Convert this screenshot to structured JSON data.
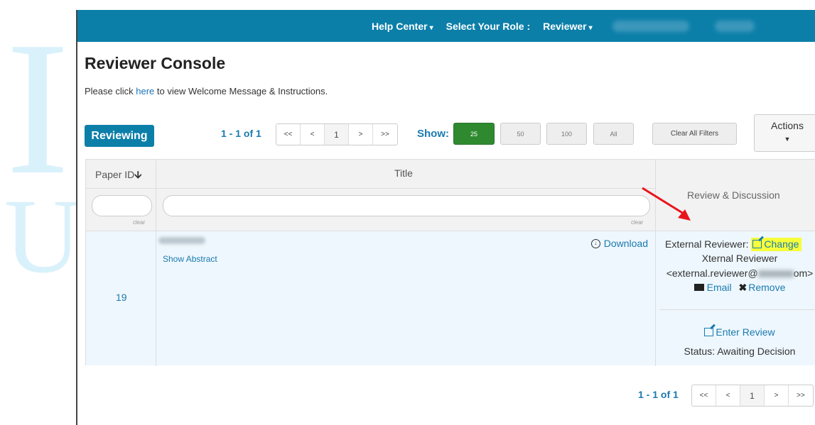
{
  "decor": {
    "letter_top": "I",
    "letter_bottom": "U"
  },
  "topbar": {
    "help_center": "Help Center",
    "select_role_label": "Select Your Role :",
    "role_value": "Reviewer"
  },
  "page": {
    "title": "Reviewer Console",
    "intro_prefix": "Please click ",
    "intro_link": "here",
    "intro_suffix": " to view Welcome Message & Instructions."
  },
  "toolbar": {
    "reviewing_label": "Reviewing",
    "pagination_info": "1 - 1 of 1",
    "pager": [
      "<<",
      "<",
      "1",
      ">",
      ">>"
    ],
    "show_label": "Show:",
    "show_options": [
      "25",
      "50",
      "100",
      "All"
    ],
    "show_selected": "25",
    "clear_filters": "Clear All Filters",
    "actions_label": "Actions"
  },
  "table": {
    "headers": {
      "paper_id": "Paper ID",
      "title": "Title",
      "review": "Review & Discussion"
    },
    "clear_label": "clear",
    "row": {
      "paper_id": "19",
      "show_abstract": "Show Abstract",
      "download": "Download",
      "external_reviewer_label": "External Reviewer:",
      "change_link": "Change",
      "reviewer_name": "Xternal Reviewer",
      "reviewer_email_prefix": "<external.reviewer@",
      "reviewer_email_suffix": "om>",
      "email_link": "Email",
      "remove_link": "Remove",
      "enter_review": "Enter Review",
      "status": "Status: Awaiting Decision"
    }
  },
  "footer": {
    "pagination_info": "1 - 1 of 1",
    "pager": [
      "<<",
      "<",
      "1",
      ">",
      ">>"
    ]
  },
  "colors": {
    "brand": "#0c7fa9",
    "link": "#1b7ab0",
    "active_show": "#2f8a2f",
    "highlight": "#f5ff3a",
    "annotation_arrow": "#e8141c"
  }
}
